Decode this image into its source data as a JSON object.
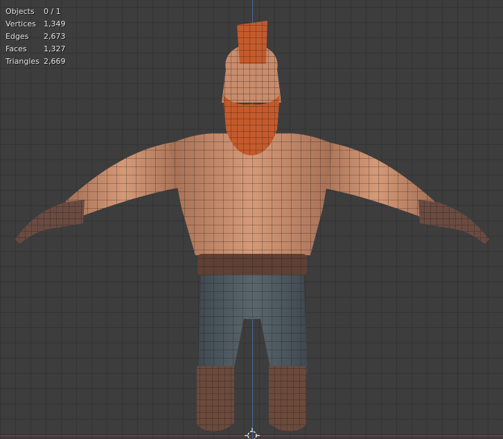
{
  "viewport": {
    "stats": [
      {
        "label": "Objects",
        "value": "0 / 1"
      },
      {
        "label": "Vertices",
        "value": "1,349"
      },
      {
        "label": "Edges",
        "value": "2,673"
      },
      {
        "label": "Faces",
        "value": "1,327"
      },
      {
        "label": "Triangles",
        "value": "2,669"
      }
    ],
    "model_icon": "character-mesh",
    "cursor_icon": "3d-cursor-icon",
    "colors": {
      "background": "#3d3d3d",
      "grid": "#343434",
      "axis_y": "#4a73a8",
      "axis_x": "#8a4444",
      "skin": "#c68b6b",
      "hair": "#c55a2c",
      "belt": "#5e4034",
      "pants": "#4f5a62",
      "boots": "#6b4a3c",
      "wire": "#1e1612"
    }
  }
}
